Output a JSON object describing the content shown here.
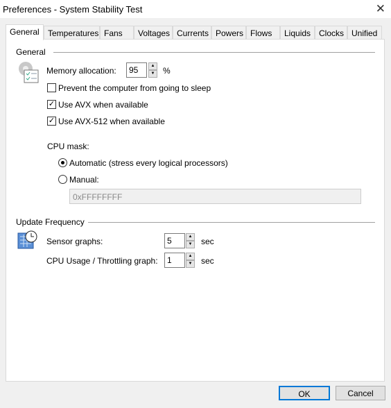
{
  "window": {
    "title": "Preferences - System Stability Test",
    "close_icon": "close-icon"
  },
  "tabs": [
    "General",
    "Temperatures",
    "Fans",
    "Voltages",
    "Currents",
    "Powers",
    "Flows",
    "Liquids",
    "Clocks",
    "Unified"
  ],
  "general": {
    "group_label": "General",
    "memory_label": "Memory allocation:",
    "memory_value": "95",
    "memory_unit": "%",
    "prevent_sleep": {
      "label": "Prevent the computer from going to sleep",
      "checked": false
    },
    "avx": {
      "label": "Use AVX when available",
      "checked": true
    },
    "avx512": {
      "label": "Use AVX-512 when available",
      "checked": true
    },
    "cpu_mask_label": "CPU mask:",
    "automatic": {
      "label": "Automatic (stress every logical processors)",
      "selected": true
    },
    "manual": {
      "label": "Manual:",
      "selected": false
    },
    "manual_value": "0xFFFFFFFF"
  },
  "update": {
    "group_label": "Update Frequency",
    "sensor_label": "Sensor graphs:",
    "sensor_value": "5",
    "sensor_unit": "sec",
    "cpu_label": "CPU Usage / Throttling graph:",
    "cpu_value": "1",
    "cpu_unit": "sec"
  },
  "buttons": {
    "ok": "OK",
    "cancel": "Cancel"
  }
}
